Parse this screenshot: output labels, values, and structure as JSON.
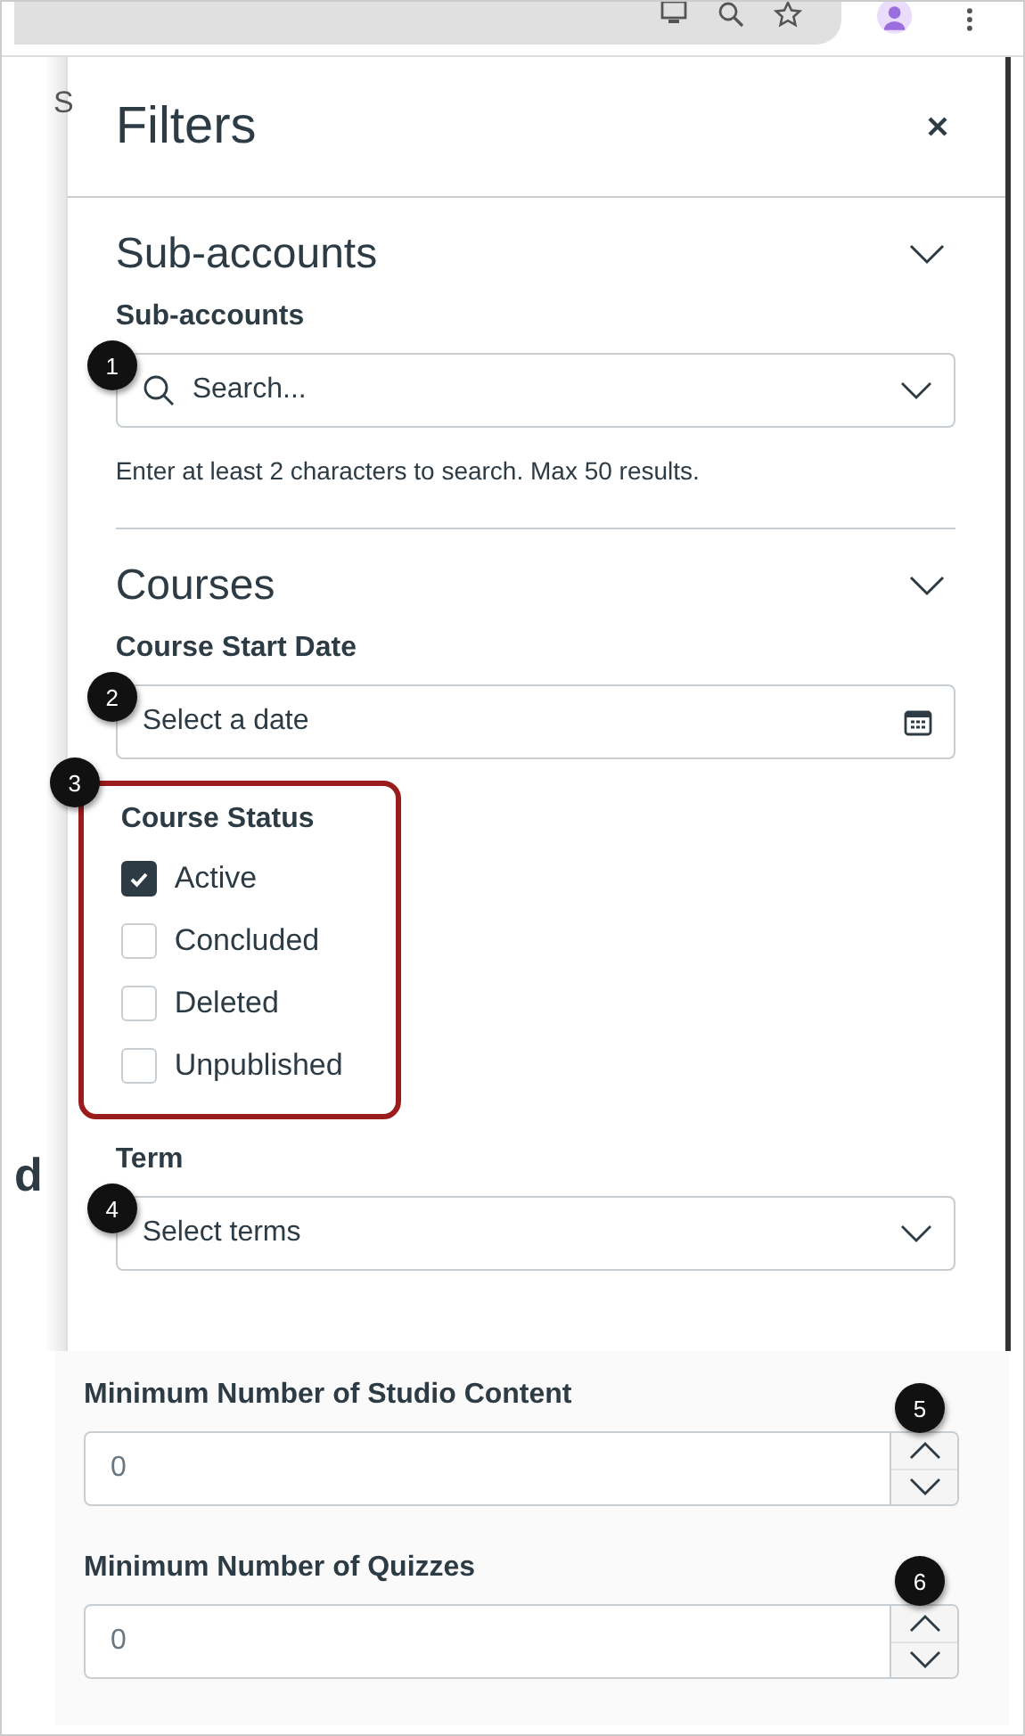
{
  "background_page": {
    "texts": [
      "S",
      "d"
    ]
  },
  "panel": {
    "title": "Filters"
  },
  "sections": [
    {
      "heading": "Sub-accounts",
      "fields": [
        {
          "kind": "search",
          "label": "Sub-accounts",
          "placeholder": "Search...",
          "callout": "1",
          "hint": "Enter at least 2 characters to search. Max 50 results."
        }
      ]
    },
    {
      "heading": "Courses",
      "fields": [
        {
          "kind": "date",
          "label": "Course Start Date",
          "placeholder": "Select a date",
          "callout": "2"
        },
        {
          "kind": "checkboxes",
          "label": "Course Status",
          "callout": "3",
          "highlighted": true,
          "options": [
            {
              "label": "Active",
              "checked": true
            },
            {
              "label": "Concluded",
              "checked": false
            },
            {
              "label": "Deleted",
              "checked": false
            },
            {
              "label": "Unpublished",
              "checked": false
            }
          ]
        },
        {
          "kind": "select",
          "label": "Term",
          "placeholder": "Select terms",
          "callout": "4"
        }
      ]
    }
  ],
  "numeric_fields": [
    {
      "label": "Minimum Number of Studio Content",
      "value": "0",
      "callout": "5"
    },
    {
      "label": "Minimum Number of Quizzes",
      "value": "0",
      "callout": "6"
    }
  ]
}
